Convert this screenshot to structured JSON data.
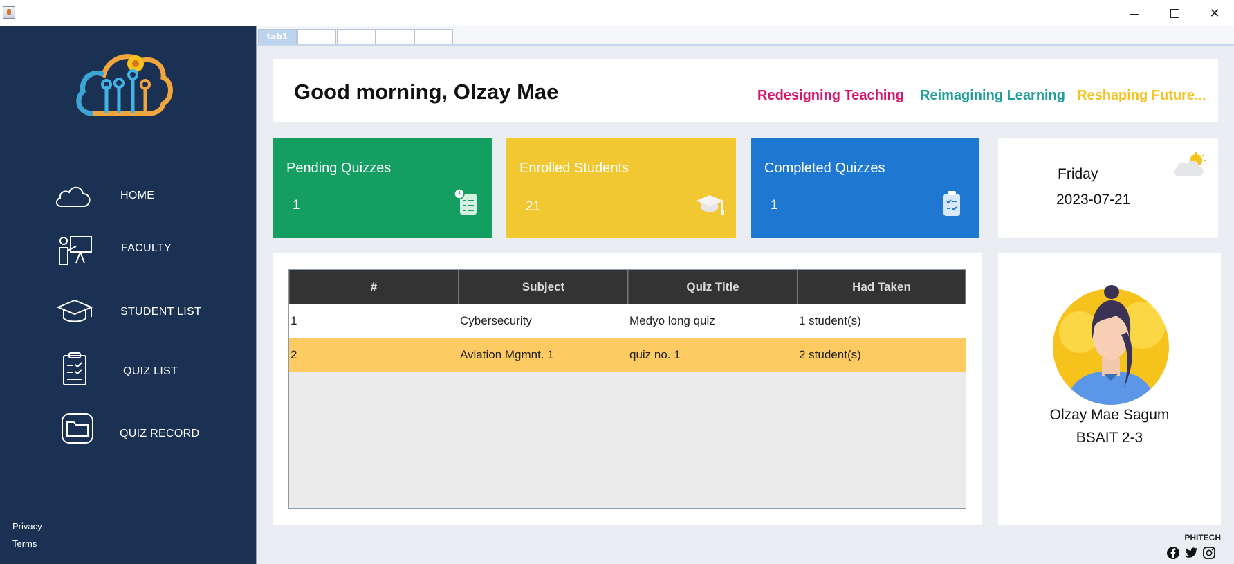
{
  "window": {
    "minimize_glyph": "",
    "close_glyph": "✕"
  },
  "sidebar": {
    "logo_icon": "cloud-circuit-logo",
    "items": [
      {
        "label": "HOME",
        "icon": "cloud-icon"
      },
      {
        "label": "FACULTY",
        "icon": "teacher-board-icon"
      },
      {
        "label": "STUDENT LIST",
        "icon": "graduation-cap-icon"
      },
      {
        "label": "QUIZ LIST",
        "icon": "clipboard-checklist-icon"
      },
      {
        "label": "QUIZ RECORD",
        "icon": "folder-icon"
      }
    ],
    "footer": {
      "privacy": "Privacy",
      "terms": "Terms"
    }
  },
  "tabs": [
    {
      "label": "tab1",
      "active": true
    },
    {
      "label": "",
      "active": false
    },
    {
      "label": "",
      "active": false
    },
    {
      "label": "",
      "active": false
    },
    {
      "label": "",
      "active": false
    }
  ],
  "header": {
    "greeting": "Good morning, Olzay Mae",
    "motto": [
      {
        "text": "Redesigning Teaching",
        "color": "#d6146b"
      },
      {
        "text": "Reimagining Learning",
        "color": "#1f9e9a"
      },
      {
        "text": "Reshaping Future...",
        "color": "#f4c21a"
      }
    ]
  },
  "stats": [
    {
      "title": "Pending Quizzes",
      "value": "1",
      "color": "#159e62",
      "icon": "clock-list-icon"
    },
    {
      "title": "Enrolled Students",
      "value": "21",
      "color": "#f2c832",
      "icon": "graduation-cap-icon"
    },
    {
      "title": "Completed Quizzes",
      "value": "1",
      "color": "#1e78d2",
      "icon": "clipboard-check-icon"
    }
  ],
  "date_card": {
    "day": "Friday",
    "date": "2023-07-21",
    "icon": "partly-cloudy-icon"
  },
  "quiz_table": {
    "columns": [
      "#",
      "Subject",
      "Quiz Title",
      "Had Taken"
    ],
    "rows": [
      {
        "num": "1",
        "subject": "Cybersecurity",
        "title": "Medyo long quiz",
        "taken": "1 student(s)",
        "selected": false
      },
      {
        "num": "2",
        "subject": "Aviation Mgmnt. 1",
        "title": "quiz no. 1",
        "taken": "2 student(s)",
        "selected": true
      }
    ],
    "selected_row_color": "#fecb62"
  },
  "profile": {
    "name": "Olzay Mae Sagum",
    "section": "BSAIT 2-3",
    "avatar": "female-avatar"
  },
  "footer": {
    "brand": "PHITECH",
    "social": [
      "facebook-icon",
      "twitter-icon",
      "instagram-icon"
    ]
  }
}
